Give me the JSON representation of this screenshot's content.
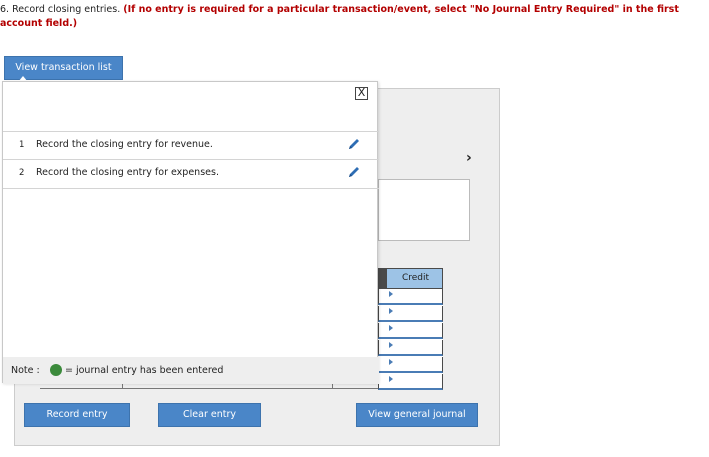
{
  "instruction": {
    "lead": "6. Record closing entries.",
    "warning": "(If no entry is required for a particular transaction/event, select \"No Journal Entry Required\" in the first account field.)"
  },
  "buttons": {
    "view_transaction_list": "View transaction list",
    "record_entry": "Record entry",
    "clear_entry": "Clear entry",
    "view_general_journal": "View general journal"
  },
  "popup": {
    "close_label": "X",
    "transactions": [
      {
        "number": "1",
        "label": "Record the closing entry for revenue."
      },
      {
        "number": "2",
        "label": "Record the closing entry for expenses."
      }
    ],
    "note": {
      "label": "Note :",
      "description": "= journal entry has been entered",
      "dot_color": "#3b8a3b"
    }
  },
  "journal": {
    "credit_header": "Credit",
    "row_count": 6
  },
  "nav": {
    "next_glyph": "›"
  },
  "colors": {
    "accent_blue": "#4a86c8",
    "header_blue": "#9dc3e6",
    "warning_red": "#b30000",
    "pencil_blue": "#2e6db4"
  }
}
